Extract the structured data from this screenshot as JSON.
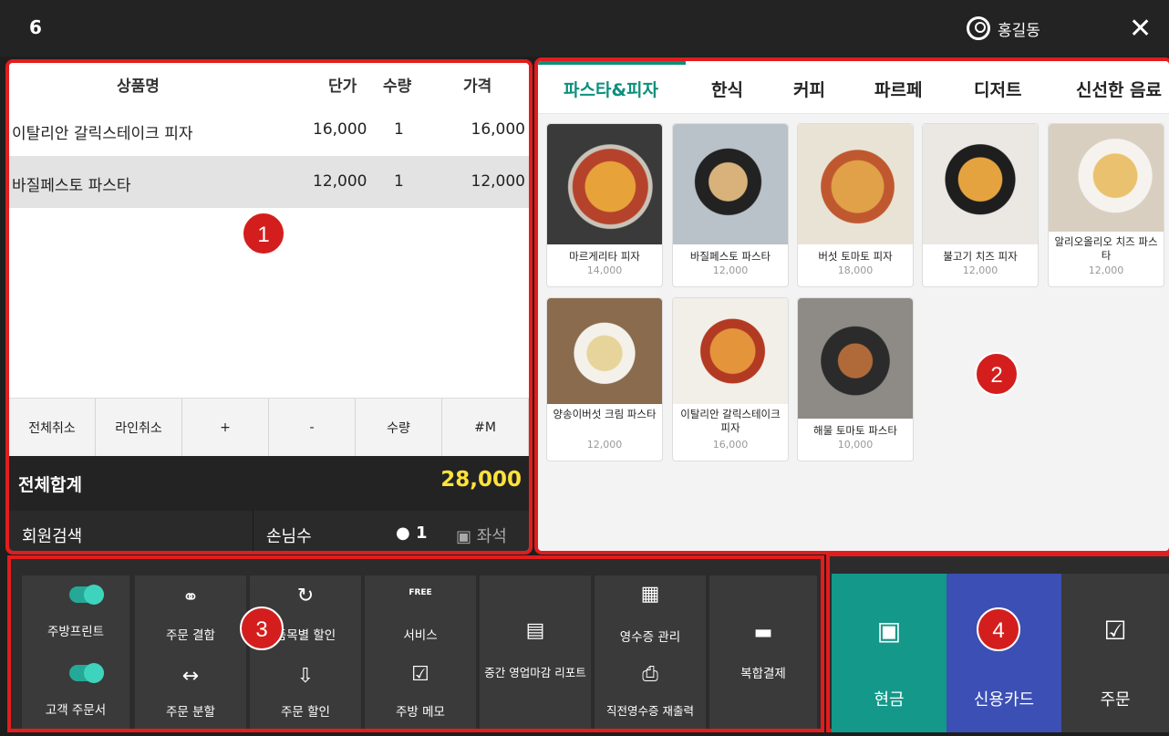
{
  "topbar": {
    "table_number": "6",
    "user_name": "홍길동"
  },
  "order": {
    "headers": {
      "name": "상품명",
      "unit_price": "단가",
      "qty": "수량",
      "price": "가격"
    },
    "rows": [
      {
        "name": "이탈리안 갈릭스테이크 피자",
        "unit_price": "16,000",
        "qty": "1",
        "price": "16,000"
      },
      {
        "name": "바질페스토 파스타",
        "unit_price": "12,000",
        "qty": "1",
        "price": "12,000"
      }
    ],
    "buttons": [
      "전체취소",
      "라인취소",
      "+",
      "-",
      "수량",
      "#M"
    ],
    "total_label": "전체합계",
    "total_value": "28,000",
    "member_search": "회원검색",
    "guest_label": "손님수",
    "guest_count": "1",
    "seat_label": "좌석"
  },
  "tabs": [
    "파스타&피자",
    "한식",
    "커피",
    "파르페",
    "디저트",
    "신선한 음료"
  ],
  "active_tab": "파스타&피자",
  "menu_items": [
    {
      "name": "마르게리타 피자",
      "price": "14,000"
    },
    {
      "name": "바질페스토 파스타",
      "price": "12,000"
    },
    {
      "name": "버섯 토마토 피자",
      "price": "18,000"
    },
    {
      "name": "불고기 치즈 피자",
      "price": "12,000"
    },
    {
      "name": "알리오올리오 치즈 파스타",
      "price": "12,000"
    },
    {
      "name": "양송이버섯 크림 파스타",
      "price": "12,000"
    },
    {
      "name": "이탈리안 갈릭스테이크 피자",
      "price": "16,000"
    },
    {
      "name": "해물 토마토 파스타",
      "price": "10,000"
    }
  ],
  "actions": {
    "kitchen_print": "주방프린트",
    "customer_order": "고객 주문서",
    "order_merge": "주문 결합",
    "item_discount": "품목별 할인",
    "service": "서비스",
    "midday_report": "중간 영업마감 리포트",
    "receipt_manage": "영수증 관리",
    "split_payment": "복합결제",
    "order_split": "주문 분할",
    "order_discount": "주문 할인",
    "kitchen_memo": "주방 메모",
    "reprint_receipt": "직전영수증 재출력",
    "free_badge": "FREE"
  },
  "payments": {
    "cash": "현금",
    "card": "신용카드",
    "order": "주문"
  },
  "annotations": [
    "1",
    "2",
    "3",
    "4"
  ],
  "colors": {
    "accent": "#0d8f7e",
    "total": "#ffe23c",
    "cash_bg": "#13988a",
    "card_bg": "#3c4fb4",
    "highlight_border": "#e21d1d"
  }
}
